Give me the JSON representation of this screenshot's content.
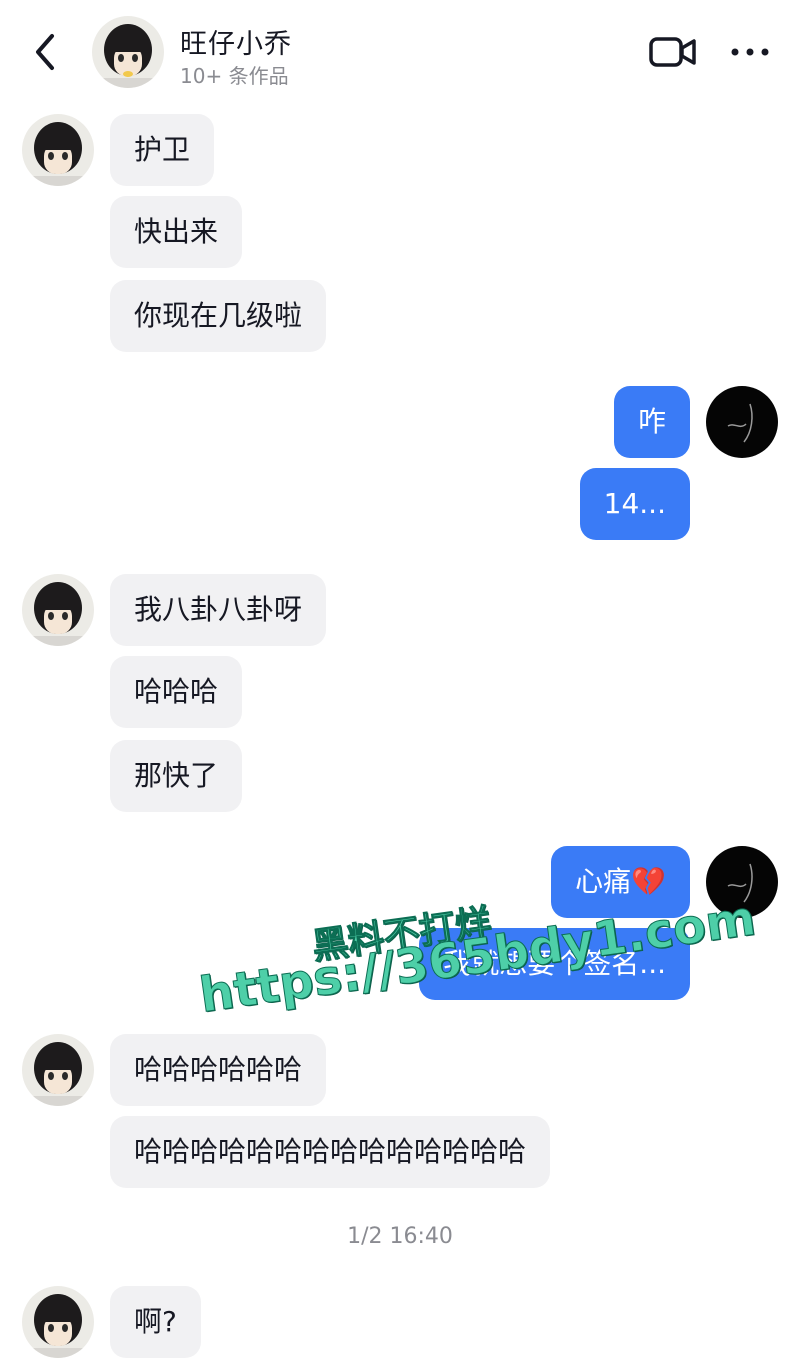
{
  "header": {
    "back_icon": "chevron-left-icon",
    "name": "旺仔小乔",
    "subtitle": "10+ 条作品",
    "video_icon": "video-camera-icon",
    "more_icon": "more-dots-icon"
  },
  "colors": {
    "incoming_bubble": "#f1f1f3",
    "outgoing_bubble": "#3a7bf6",
    "watermark": "#4ecfa8"
  },
  "messages": [
    {
      "from": "them",
      "text": "护卫"
    },
    {
      "from": "them",
      "text": "快出来"
    },
    {
      "from": "them",
      "text": "你现在几级啦"
    },
    {
      "from": "me",
      "text": "咋"
    },
    {
      "from": "me",
      "text": "14..."
    },
    {
      "from": "them",
      "text": "我八卦八卦呀"
    },
    {
      "from": "them",
      "text": "哈哈哈"
    },
    {
      "from": "them",
      "text": "那快了"
    },
    {
      "from": "me",
      "text": "心痛💔"
    },
    {
      "from": "me",
      "text": "我就想要个签名..."
    },
    {
      "from": "them",
      "text": "哈哈哈哈哈哈"
    },
    {
      "from": "them",
      "text": "哈哈哈哈哈哈哈哈哈哈哈哈哈哈"
    },
    {
      "from": "them",
      "text": "啊?"
    }
  ],
  "timestamp": "1/2 16:40",
  "watermark": {
    "line1": "黑料不打烊",
    "line2": "https://365bdy1.com"
  }
}
